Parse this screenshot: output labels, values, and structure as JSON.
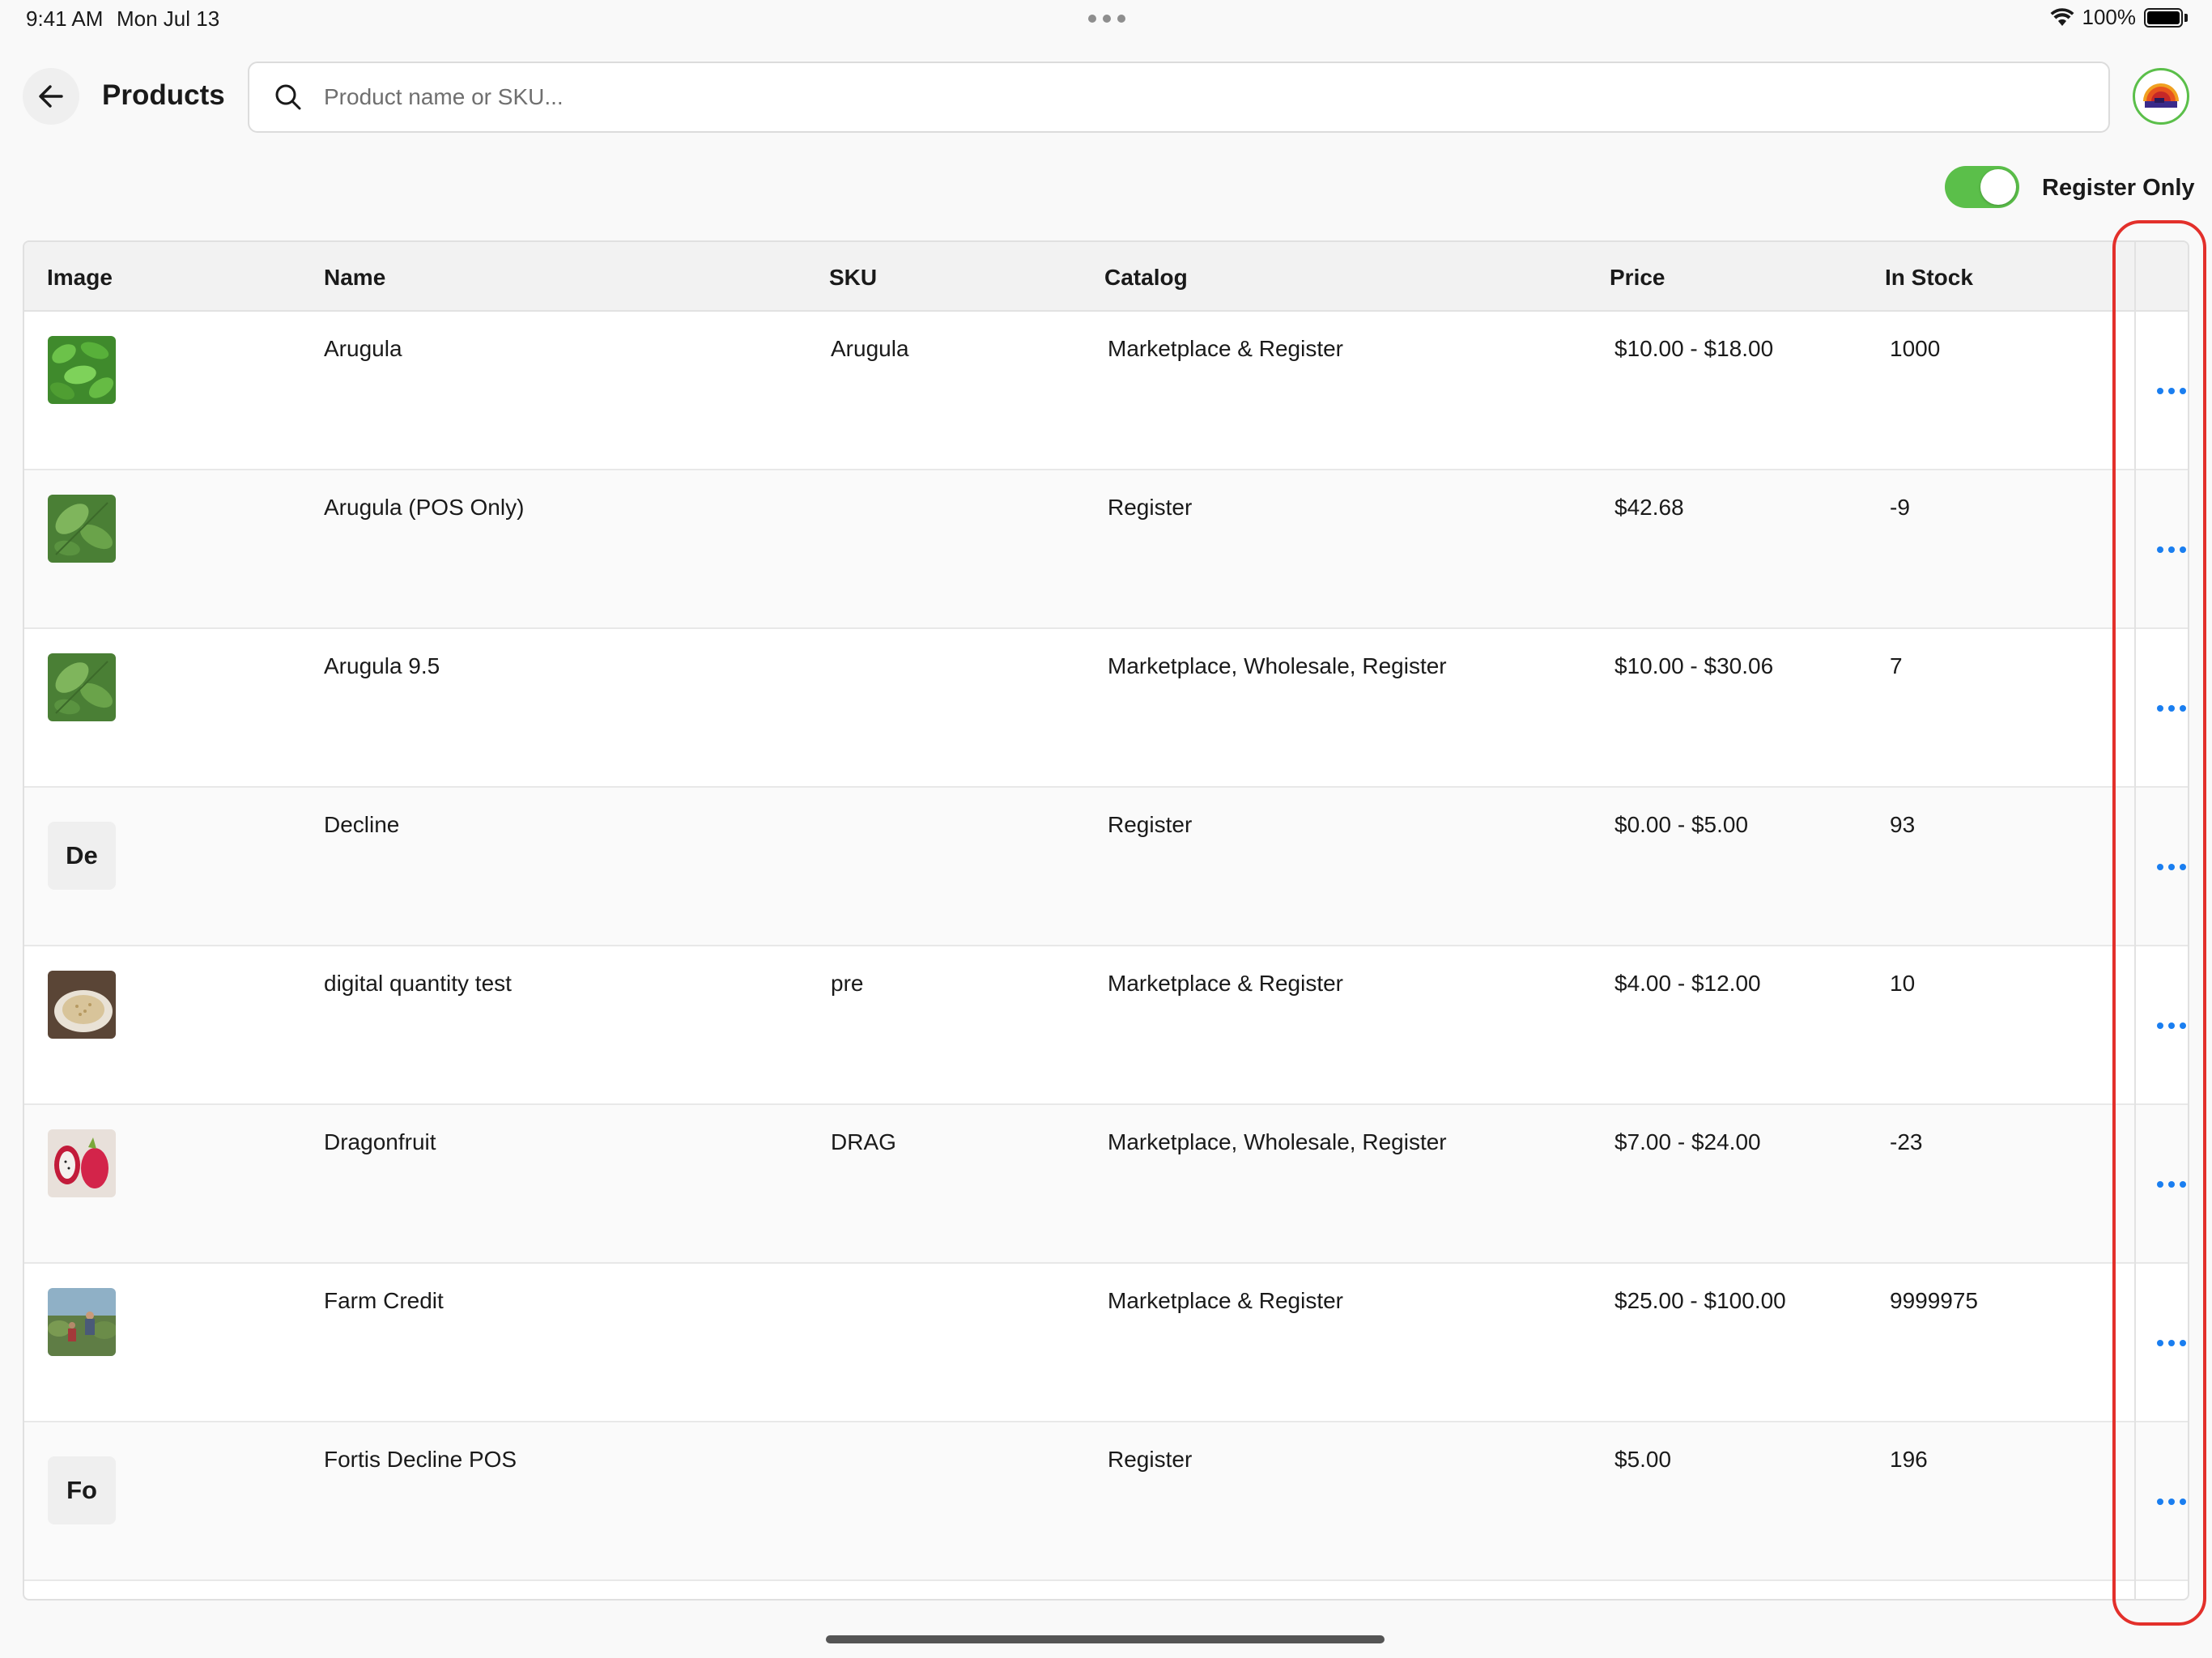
{
  "status": {
    "time": "9:41 AM",
    "date": "Mon Jul 13",
    "battery": "100%"
  },
  "header": {
    "title": "Products"
  },
  "search": {
    "placeholder": "Product name or SKU..."
  },
  "filter": {
    "label": "Register Only",
    "enabled": true
  },
  "table": {
    "columns": [
      "Image",
      "Name",
      "SKU",
      "Catalog",
      "Price",
      "In Stock"
    ],
    "rows": [
      {
        "image": "arugula-photo",
        "initials": "",
        "name": "Arugula",
        "sku": "Arugula",
        "catalog": "Marketplace & Register",
        "price": "$10.00 - $18.00",
        "stock": "1000"
      },
      {
        "image": "arugula-photo",
        "initials": "",
        "name": "Arugula (POS Only)",
        "sku": "",
        "catalog": "Register",
        "price": "$42.68",
        "stock": "-9"
      },
      {
        "image": "arugula-photo",
        "initials": "",
        "name": "Arugula 9.5",
        "sku": "",
        "catalog": "Marketplace, Wholesale, Register",
        "price": "$10.00 - $30.06",
        "stock": "7"
      },
      {
        "image": "",
        "initials": "De",
        "name": "Decline",
        "sku": "",
        "catalog": "Register",
        "price": "$0.00 - $5.00",
        "stock": "93"
      },
      {
        "image": "grain-photo",
        "initials": "",
        "name": "digital quantity test",
        "sku": "pre",
        "catalog": "Marketplace & Register",
        "price": "$4.00 - $12.00",
        "stock": "10"
      },
      {
        "image": "dragonfruit-photo",
        "initials": "",
        "name": "Dragonfruit",
        "sku": "DRAG",
        "catalog": "Marketplace, Wholesale, Register",
        "price": "$7.00 - $24.00",
        "stock": "-23"
      },
      {
        "image": "farm-photo",
        "initials": "",
        "name": "Farm Credit",
        "sku": "",
        "catalog": "Marketplace & Register",
        "price": "$25.00 - $100.00",
        "stock": "9999975"
      },
      {
        "image": "",
        "initials": "Fo",
        "name": "Fortis Decline POS",
        "sku": "",
        "catalog": "Register",
        "price": "$5.00",
        "stock": "196"
      }
    ]
  },
  "colors": {
    "accent_green": "#5bbf4a",
    "action_blue": "#1a7ef0",
    "highlight_red": "#e3302b"
  }
}
